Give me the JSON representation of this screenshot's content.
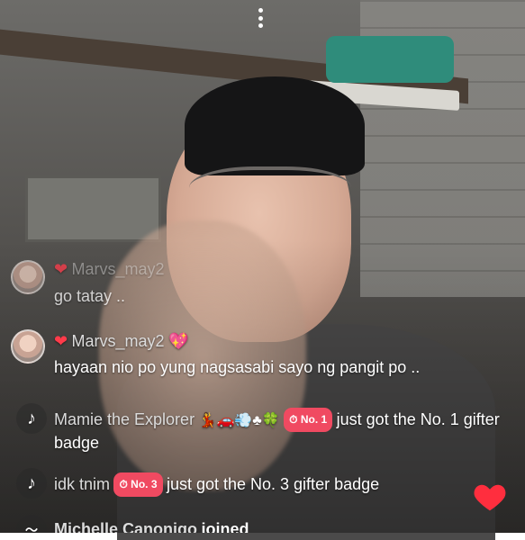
{
  "menu": {
    "icon": "vertical-dots-icon"
  },
  "comments": [
    {
      "username": "Marvs_may2",
      "text": "go tatay ..",
      "icon": "avatar"
    },
    {
      "username": "Marvs_may2",
      "text": "hayaan nio po yung nagsasabi sayo ng pangit po ..",
      "icon": "avatar"
    },
    {
      "username": "Mamie the Explorer",
      "emojis": "💃🚗💨♣🍀",
      "badge": "No. 1",
      "text": "just got the No. 1 gifter badge",
      "icon": "tiktok-logo"
    },
    {
      "username": "idk tnim",
      "badge": "No. 3",
      "text": "just got the No. 3 gifter badge",
      "icon": "tiktok-logo"
    },
    {
      "username": "Michelle Canonigo",
      "text": "joined",
      "icon": "wave-icon"
    }
  ],
  "like_button": {
    "icon": "heart-icon",
    "color": "#ff2e3e"
  }
}
